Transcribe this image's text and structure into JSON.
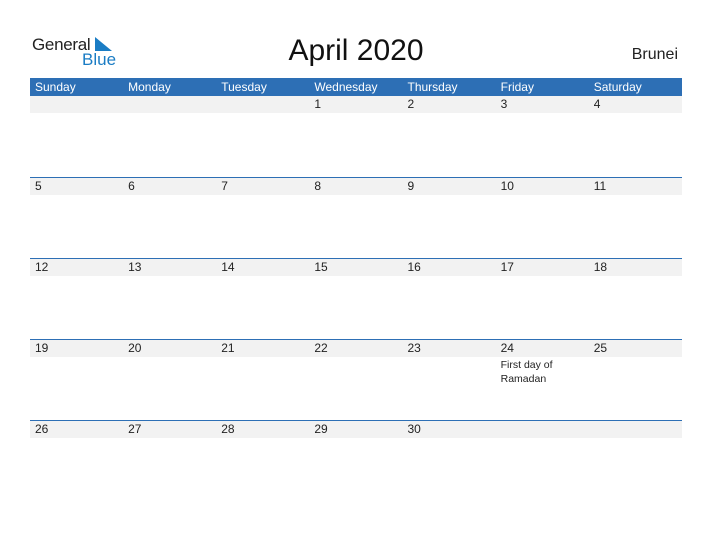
{
  "logo": {
    "general": "General",
    "blue": "Blue",
    "icon": "triangle-flag-icon"
  },
  "title": "April 2020",
  "country": "Brunei",
  "colors": {
    "header_bg": "#2d6fb5",
    "day_bar_bg": "#f2f2f2",
    "logo_blue": "#1a7cc4"
  },
  "weekdays": [
    "Sunday",
    "Monday",
    "Tuesday",
    "Wednesday",
    "Thursday",
    "Friday",
    "Saturday"
  ],
  "weeks": [
    {
      "days": [
        "",
        "",
        "",
        "1",
        "2",
        "3",
        "4"
      ],
      "events": [
        "",
        "",
        "",
        "",
        "",
        "",
        ""
      ]
    },
    {
      "days": [
        "5",
        "6",
        "7",
        "8",
        "9",
        "10",
        "11"
      ],
      "events": [
        "",
        "",
        "",
        "",
        "",
        "",
        ""
      ]
    },
    {
      "days": [
        "12",
        "13",
        "14",
        "15",
        "16",
        "17",
        "18"
      ],
      "events": [
        "",
        "",
        "",
        "",
        "",
        "",
        ""
      ]
    },
    {
      "days": [
        "19",
        "20",
        "21",
        "22",
        "23",
        "24",
        "25"
      ],
      "events": [
        "",
        "",
        "",
        "",
        "",
        "First day of Ramadan",
        ""
      ]
    },
    {
      "days": [
        "26",
        "27",
        "28",
        "29",
        "30",
        "",
        ""
      ],
      "events": [
        "",
        "",
        "",
        "",
        "",
        "",
        ""
      ]
    }
  ]
}
